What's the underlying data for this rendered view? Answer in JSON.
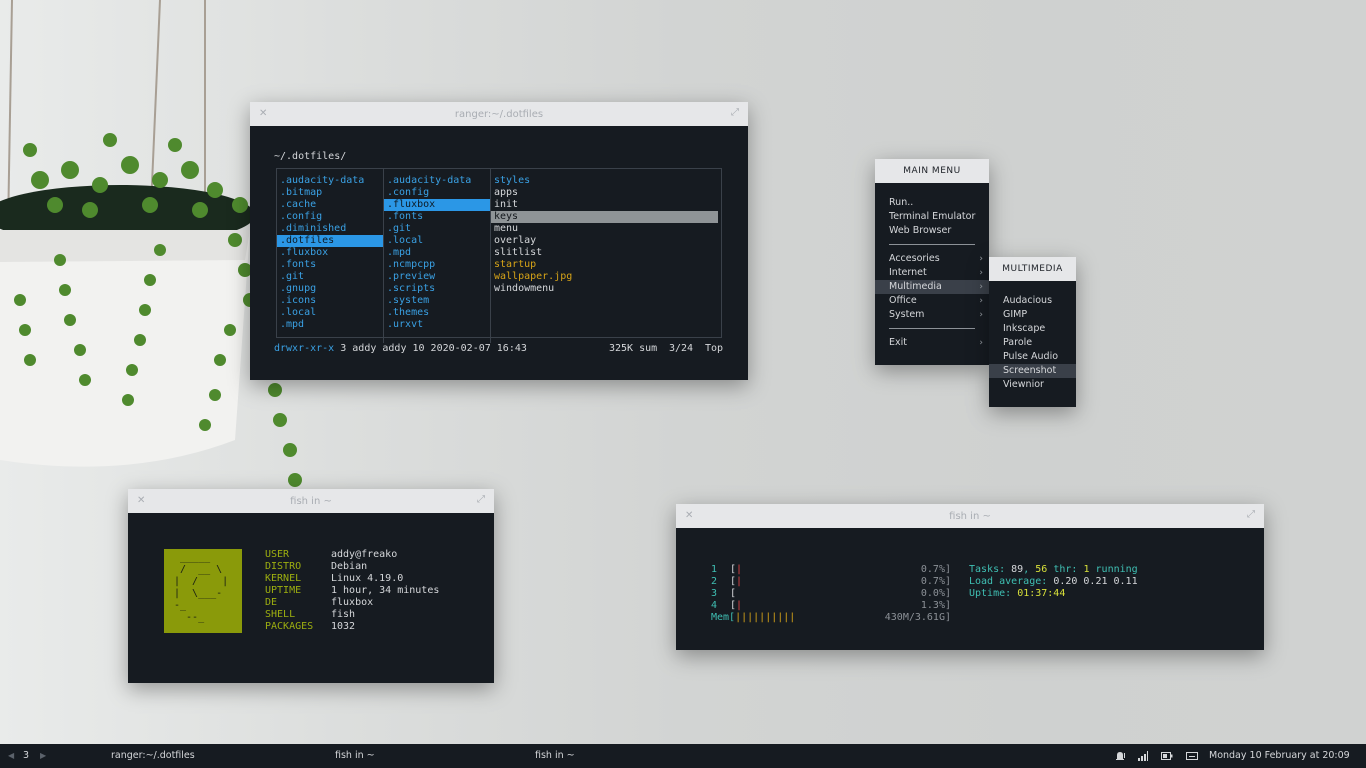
{
  "ranger": {
    "title": "ranger:~/.dotfiles",
    "path": "~/.dotfiles/",
    "col1": [
      ".audacity-data",
      ".bitmap",
      ".cache",
      ".config",
      ".diminished",
      ".dotfiles",
      ".fluxbox",
      ".fonts",
      ".git",
      ".gnupg",
      ".icons",
      ".local",
      ".mpd"
    ],
    "col2": [
      ".audacity-data",
      ".config",
      ".fluxbox",
      ".fonts",
      ".git",
      ".local",
      ".mpd",
      ".ncmpcpp",
      ".preview",
      ".scripts",
      ".system",
      ".themes",
      ".urxvt"
    ],
    "col3": [
      "styles",
      "apps",
      "init",
      "keys",
      "menu",
      "overlay",
      "slitlist",
      "startup",
      "wallpaper.jpg",
      "windowmenu"
    ],
    "status": {
      "perms": "drwxr-xr-x",
      "info": "3 addy addy 10 2020-02-07 16:43",
      "sum": "325K sum",
      "pos": "3/24",
      "top": "Top"
    }
  },
  "main_menu": {
    "title": "MAIN MENU",
    "items": [
      "Run..",
      "Terminal Emulator",
      "Web Browser"
    ],
    "submenus": [
      "Accesories",
      "Internet",
      "Multimedia",
      "Office",
      "System"
    ],
    "exit": "Exit"
  },
  "multimedia_menu": {
    "title": "MULTIMEDIA",
    "items": [
      "Audacious",
      "GIMP",
      "Inkscape",
      "Parole",
      "Pulse Audio",
      "Screenshot",
      "Viewnior"
    ]
  },
  "fetch": {
    "title": "fish in ~",
    "ascii": " _____\n /  __ \\\n|  /    |\n|  \\___-\n-_\n  --_",
    "labels": [
      "USER",
      "DISTRO",
      "KERNEL",
      "UPTIME",
      "DE",
      "SHELL",
      "PACKAGES"
    ],
    "values": [
      "addy@freako",
      "Debian",
      "Linux 4.19.0",
      "1 hour, 34 minutes",
      "fluxbox",
      "fish",
      "1032"
    ]
  },
  "htop": {
    "title": "fish in ~",
    "cpus": [
      {
        "n": "1",
        "bar": "|",
        "pct": "0.7%]"
      },
      {
        "n": "2",
        "bar": "|",
        "pct": "0.7%]"
      },
      {
        "n": "3",
        "bar": "",
        "pct": "0.0%]"
      },
      {
        "n": "4",
        "bar": "|",
        "pct": "1.3%]"
      }
    ],
    "mem_label": "Mem[",
    "mem_bar": "||||||||||",
    "mem_value": "430M/3.61G]",
    "tasks_label": "Tasks:",
    "tasks_count": "89",
    "thr_count": "56",
    "thr_label": "thr:",
    "running_count": "1",
    "running_label": "running",
    "load_label": "Load average:",
    "load_values": "0.20 0.21 0.11",
    "uptime_label": "Uptime:",
    "uptime_value": "01:37:44"
  },
  "taskbar": {
    "workspace": "3",
    "tasks": [
      "ranger:~/.dotfiles",
      "fish in ~",
      "fish in ~"
    ],
    "clock": "Monday 10 February at 20:09"
  },
  "colors": {
    "terminal_bg": "#161b21",
    "titlebar": "#e6e7e9",
    "accent_blue": "#2b97e6",
    "accent_yellow": "#d7a418",
    "logo_bg": "#8a9a0a"
  }
}
